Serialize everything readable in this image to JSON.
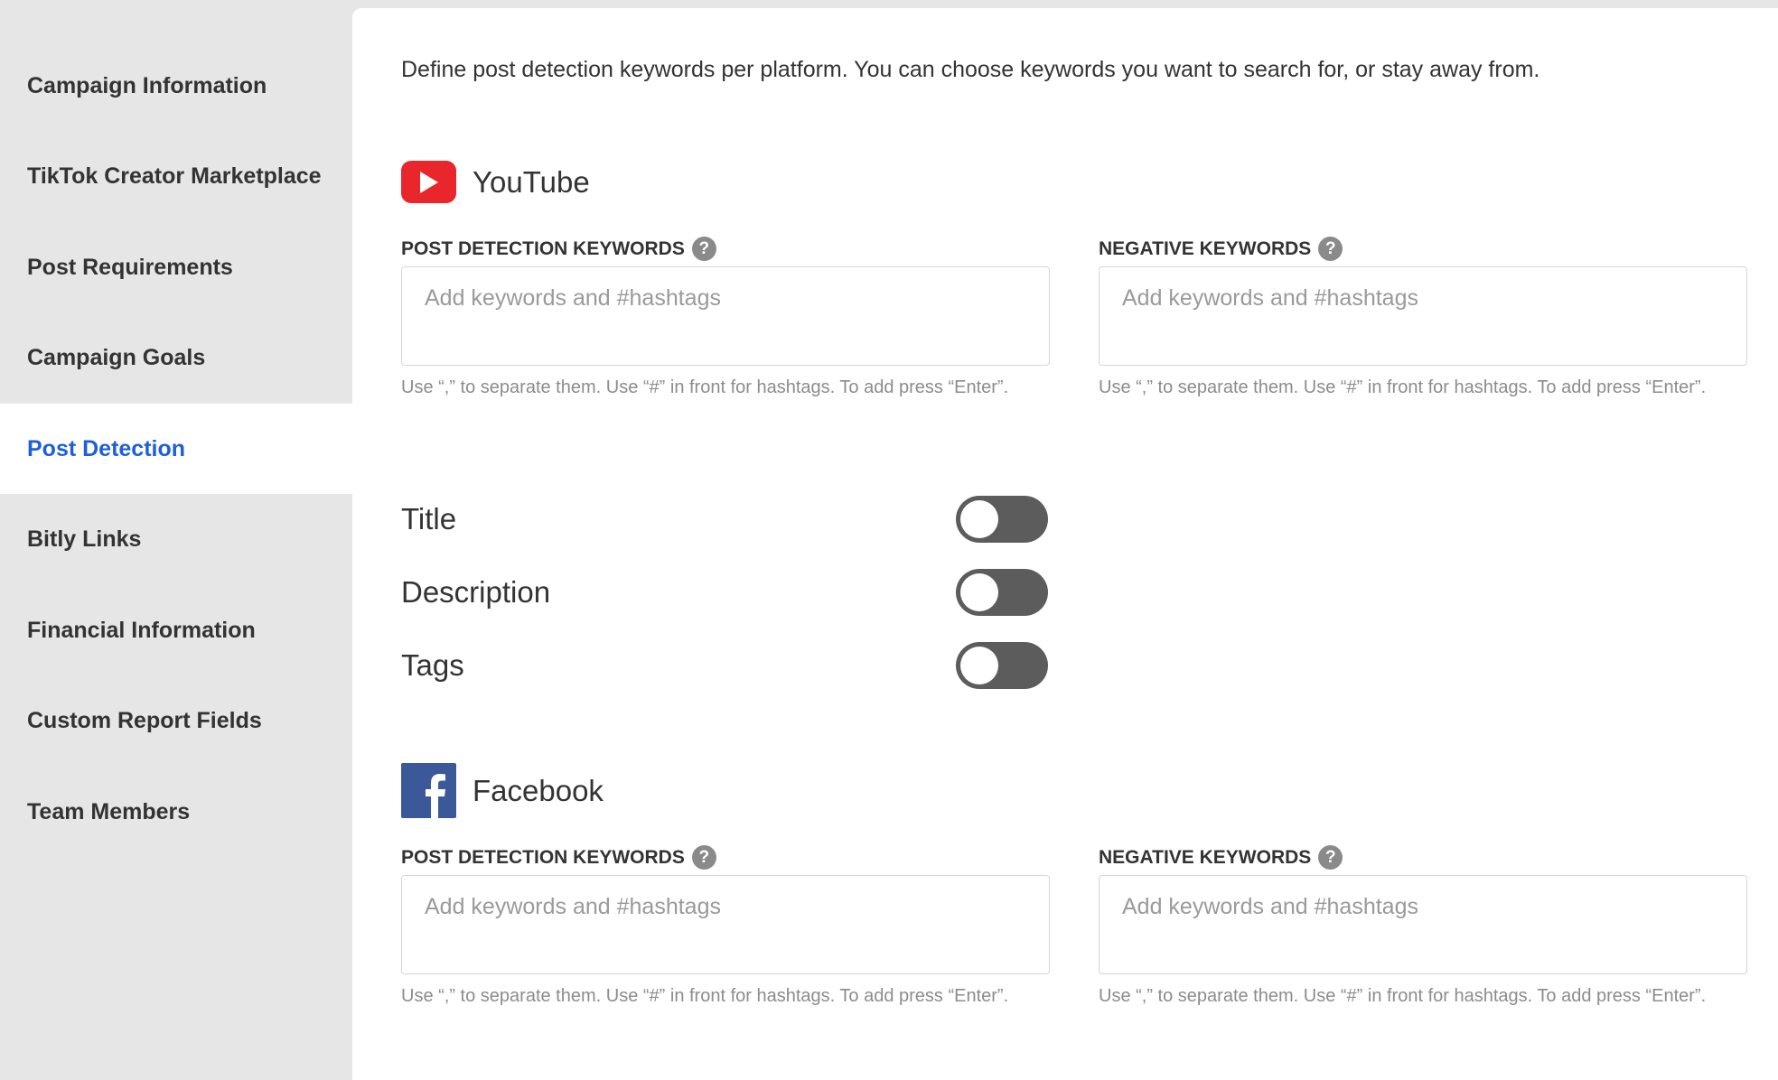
{
  "sidebar": {
    "items": [
      {
        "label": "Campaign Information",
        "active": false
      },
      {
        "label": "TikTok Creator Marketplace",
        "active": false
      },
      {
        "label": "Post Requirements",
        "active": false
      },
      {
        "label": "Campaign Goals",
        "active": false
      },
      {
        "label": "Post Detection",
        "active": true
      },
      {
        "label": "Bitly Links",
        "active": false
      },
      {
        "label": "Financial Information",
        "active": false
      },
      {
        "label": "Custom Report Fields",
        "active": false
      },
      {
        "label": "Team Members",
        "active": false
      }
    ]
  },
  "main": {
    "intro": "Define post detection keywords per platform. You can choose keywords you want to search for, or stay away from.",
    "youtube": {
      "title": "YouTube",
      "keywords_label": "POST DETECTION KEYWORDS",
      "negative_label": "NEGATIVE KEYWORDS",
      "keywords_value": "",
      "negative_value": "",
      "placeholder": "Add keywords and #hashtags",
      "hint": "Use “,” to separate them. Use “#” in front for hashtags. To add press “Enter”.",
      "toggles": [
        {
          "label": "Title",
          "on": false
        },
        {
          "label": "Description",
          "on": false
        },
        {
          "label": "Tags",
          "on": false
        }
      ]
    },
    "facebook": {
      "title": "Facebook",
      "keywords_label": "POST DETECTION KEYWORDS",
      "negative_label": "NEGATIVE KEYWORDS",
      "keywords_value": "",
      "negative_value": "",
      "placeholder": "Add keywords and #hashtags",
      "hint": "Use “,” to separate them. Use “#” in front for hashtags. To add press “Enter”."
    },
    "help_glyph": "?"
  },
  "colors": {
    "accent": "#1e5fd6",
    "youtube_red": "#e8262b",
    "facebook_blue": "#3b5998",
    "toggle_off": "#5c5c5c"
  },
  "icons": [
    "youtube-logo-icon",
    "facebook-logo-icon",
    "help-icon"
  ]
}
